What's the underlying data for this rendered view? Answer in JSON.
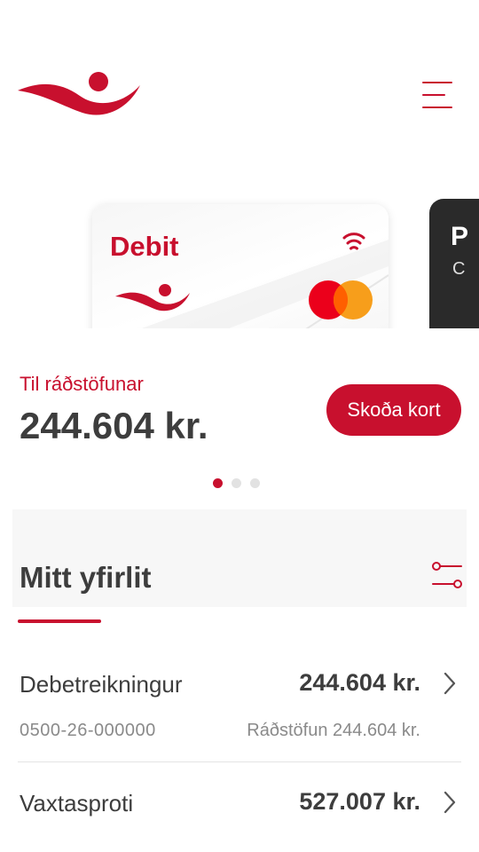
{
  "header": {
    "logo_icon": "bank-swoosh-logo",
    "menu_icon": "hamburger-menu-icon"
  },
  "cards": [
    {
      "title": "Debit",
      "network": "mastercard",
      "contactless_icon": "contactless-icon"
    },
    {
      "title": "P",
      "subtitle": "C"
    }
  ],
  "balance": {
    "label": "Til ráðstöfunar",
    "amount": "244.604 kr.",
    "view_card_label": "Skoða kort"
  },
  "carousel": {
    "page_count": 3,
    "active_page": 1
  },
  "overview": {
    "title": "Mitt yfirlit",
    "filter_icon": "filter-sliders-icon"
  },
  "accounts": [
    {
      "name": "Debetreikningur",
      "amount": "244.604 kr.",
      "number": "0500-26-000000",
      "available": "Ráðstöfun 244.604 kr."
    },
    {
      "name": "Vaxtasproti",
      "amount": "527.007 kr."
    }
  ],
  "colors": {
    "brand": "#c8102e",
    "text": "#3d3d3d",
    "muted": "#8a8a8a"
  }
}
